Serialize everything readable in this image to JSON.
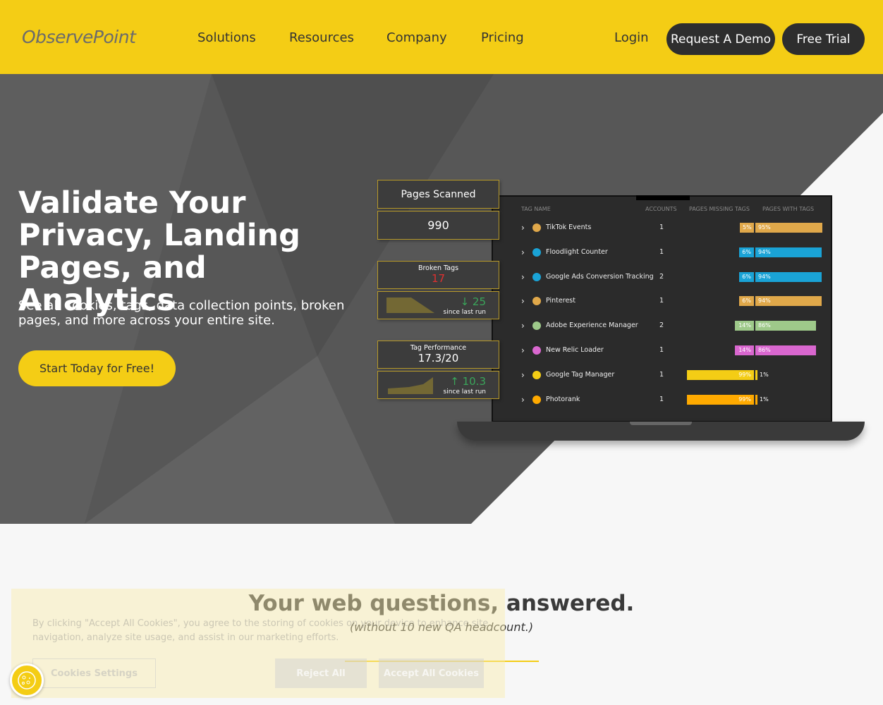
{
  "header": {
    "logo": "ObservePoint",
    "nav": [
      "Solutions",
      "Resources",
      "Company",
      "Pricing"
    ],
    "login": "Login",
    "demo": "Request A Demo",
    "trial": "Free Trial"
  },
  "hero": {
    "title": "Validate Your Privacy, Landing Pages, and Analytics",
    "subtitle": "See all cookies, tags, data collection points, broken pages, and more across your entire site.",
    "cta": "Start Today for Free!"
  },
  "stats": {
    "pages_label": "Pages Scanned",
    "pages_value": "990",
    "broken_label": "Broken Tags",
    "broken_value": "17",
    "broken_delta": "↓ 25",
    "broken_since": "since last run",
    "perf_label": "Tag Performance",
    "perf_value": "17.3/20",
    "perf_delta": "↑ 10.3",
    "perf_since": "since last run"
  },
  "table": {
    "headers": [
      "TAG NAME",
      "ACCOUNTS",
      "PAGES MISSING TAGS",
      "PAGES WITH TAGS"
    ],
    "rows": [
      {
        "name": "TikTok Events",
        "accounts": "1",
        "missing": 5,
        "with": 95,
        "color": "#e0a84a",
        "icon": "tiktok-icon"
      },
      {
        "name": "Floodlight Counter",
        "accounts": "1",
        "missing": 6,
        "with": 94,
        "color": "#1aa3d6",
        "icon": "floodlight-icon"
      },
      {
        "name": "Google Ads Conversion Tracking",
        "accounts": "2",
        "missing": 6,
        "with": 94,
        "color": "#1aa3d6",
        "icon": "google-ads-icon"
      },
      {
        "name": "Pinterest",
        "accounts": "1",
        "missing": 6,
        "with": 94,
        "color": "#e0a84a",
        "icon": "pinterest-icon"
      },
      {
        "name": "Adobe Experience Manager",
        "accounts": "2",
        "missing": 14,
        "with": 86,
        "color": "#9ec98a",
        "icon": "adobe-icon"
      },
      {
        "name": "New Relic Loader",
        "accounts": "1",
        "missing": 14,
        "with": 86,
        "color": "#d967cf",
        "icon": "new-relic-icon"
      },
      {
        "name": "Google Tag Manager",
        "accounts": "1",
        "missing": 99,
        "with": 1,
        "color": "#f4cd15",
        "icon": "gtm-icon"
      },
      {
        "name": "Photorank",
        "accounts": "1",
        "missing": 99,
        "with": 1,
        "color": "#ffaa00",
        "icon": "photorank-icon"
      }
    ]
  },
  "section": {
    "title": "Your web questions, answered.",
    "subtitle": "(without 10 new QA headcount.)"
  },
  "cookie": {
    "text": "By clicking \"Accept All Cookies\", you agree to the storing of cookies on your device to enhance site navigation, analyze site usage, and assist in our marketing efforts.",
    "settings": "Cookies Settings",
    "reject": "Reject All",
    "accept": "Accept All Cookies"
  }
}
